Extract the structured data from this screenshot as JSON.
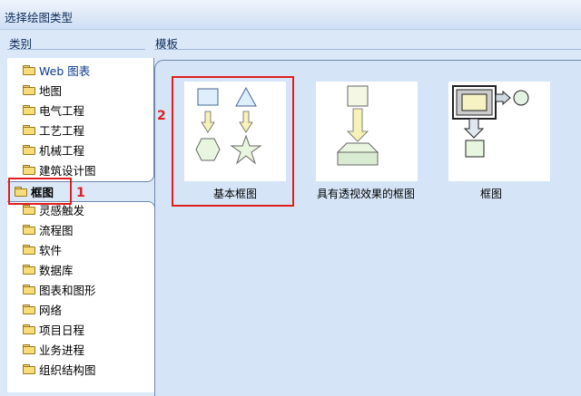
{
  "window": {
    "title": "选择绘图类型"
  },
  "sections": {
    "category": "类别",
    "template": "模板"
  },
  "categories": [
    {
      "label": "Web 图表"
    },
    {
      "label": "地图"
    },
    {
      "label": "电气工程"
    },
    {
      "label": "工艺工程"
    },
    {
      "label": "机械工程"
    },
    {
      "label": "建筑设计图"
    },
    {
      "label": "框图",
      "selected": true
    },
    {
      "label": "灵感触发"
    },
    {
      "label": "流程图"
    },
    {
      "label": "软件"
    },
    {
      "label": "数据库"
    },
    {
      "label": "图表和图形"
    },
    {
      "label": "网络"
    },
    {
      "label": "项目日程"
    },
    {
      "label": "业务进程"
    },
    {
      "label": "组织结构图"
    }
  ],
  "templates": [
    {
      "label": "基本框图",
      "icon": "basic-block-diagram-icon"
    },
    {
      "label": "具有透视效果的框图",
      "icon": "perspective-block-diagram-icon"
    },
    {
      "label": "框图",
      "icon": "block-diagram-icon"
    }
  ],
  "callouts": {
    "first": "1",
    "second": "2"
  },
  "colors": {
    "accent": "#e02020",
    "panel": "#d5e4f6",
    "folder": "#f7dc7a"
  }
}
